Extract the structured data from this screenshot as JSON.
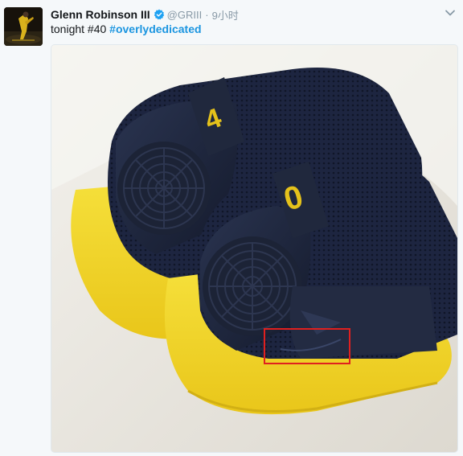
{
  "tweet": {
    "display_name": "Glenn Robinson III",
    "handle": "@GRIII",
    "separator": "·",
    "timestamp": "9小时",
    "text_prefix": "tonight #40 ",
    "hashtag": "#overlydedicated",
    "verified_color": "#1da1f2",
    "link_color": "#1b95e0"
  },
  "media": {
    "heel_numbers": [
      "4",
      "0"
    ],
    "highlight_box_color": "#e0201f"
  },
  "icons": {
    "verified": "verified-badge-icon",
    "caret": "chevron-down-icon"
  }
}
